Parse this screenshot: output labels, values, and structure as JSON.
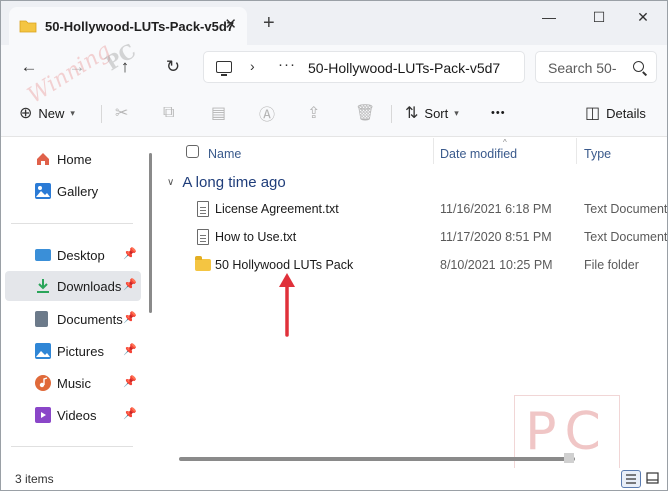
{
  "window": {
    "tab_title": "50-Hollywood-LUTs-Pack-v5d7",
    "tab_close": "✕",
    "new_tab": "+",
    "minimize": "—",
    "maximize": "☐",
    "close": "✕"
  },
  "navigation": {
    "back": "←",
    "forward": "→",
    "up": "↑",
    "refresh": "↻",
    "address_separator": "›",
    "address_more": "···",
    "address_path": "50-Hollywood-LUTs-Pack-v5d7",
    "search_placeholder": "Search 50-"
  },
  "toolbar": {
    "new_label": "New",
    "sort_label": "Sort",
    "more_label": "•••",
    "details_label": "Details"
  },
  "sidebar": {
    "items": [
      {
        "label": "Home",
        "pinned": false,
        "color": "#e0614a"
      },
      {
        "label": "Gallery",
        "pinned": false,
        "color": "#2b7bd6"
      },
      {
        "label": "Desktop",
        "pinned": true,
        "color": "#3a8fd8"
      },
      {
        "label": "Downloads",
        "pinned": true,
        "color": "#2aa55a",
        "selected": true
      },
      {
        "label": "Documents",
        "pinned": true,
        "color": "#6c7a8a"
      },
      {
        "label": "Pictures",
        "pinned": true,
        "color": "#2f86d6"
      },
      {
        "label": "Music",
        "pinned": true,
        "color": "#e06a3a"
      },
      {
        "label": "Videos",
        "pinned": true,
        "color": "#8a46c8"
      }
    ],
    "pin_glyph": "📌"
  },
  "columns": {
    "name": "Name",
    "date_modified": "Date modified",
    "type": "Type"
  },
  "group": {
    "label": "A long time ago"
  },
  "files": [
    {
      "name": "License Agreement.txt",
      "date": "11/16/2021 6:18 PM",
      "type": "Text Document",
      "icon": "text-document"
    },
    {
      "name": "How to Use.txt",
      "date": "11/17/2020 8:51 PM",
      "type": "Text Document",
      "icon": "text-document"
    },
    {
      "name": "50 Hollywood LUTs Pack",
      "date": "8/10/2021 10:25 PM",
      "type": "File folder",
      "icon": "folder"
    }
  ],
  "status": {
    "item_count": "3 items"
  },
  "watermark": {
    "pc": "PC",
    "script": "Winning",
    "script_pc": "PC"
  },
  "colors": {
    "accent": "#1f3d7a",
    "arrow": "#e0303a",
    "folder": "#f4c542"
  }
}
